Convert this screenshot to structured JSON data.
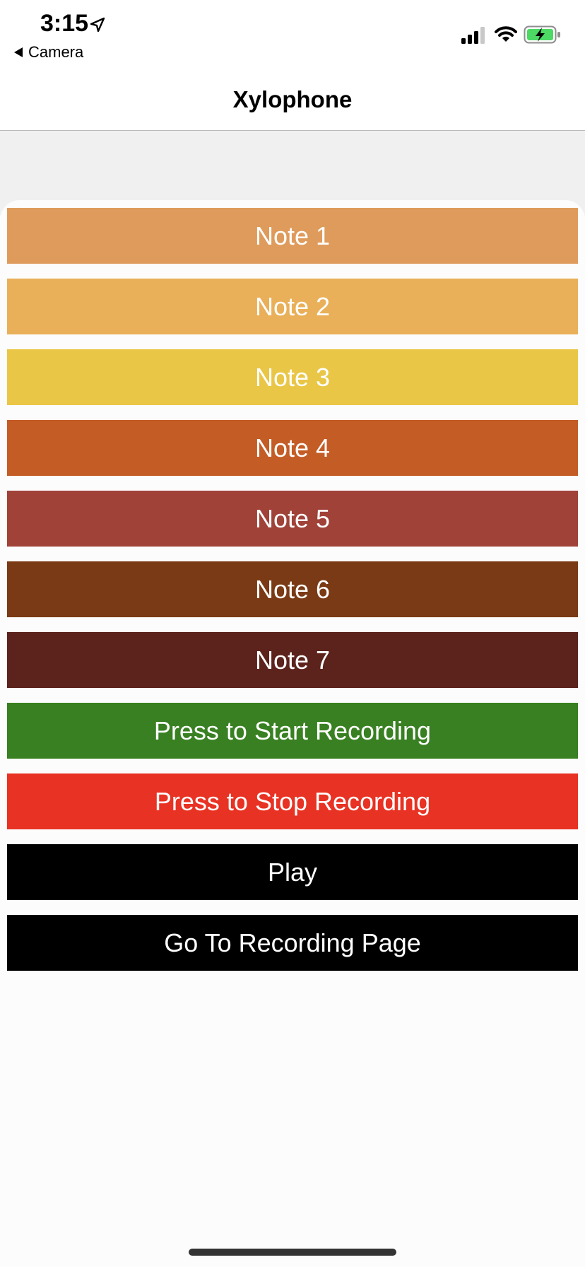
{
  "status_bar": {
    "time": "3:15",
    "back_app": "Camera",
    "battery_color": "#4cd964"
  },
  "nav": {
    "title": "Xylophone"
  },
  "notes": [
    {
      "label": "Note 1",
      "color": "#df9b5b"
    },
    {
      "label": "Note 2",
      "color": "#e9b059"
    },
    {
      "label": "Note 3",
      "color": "#e9c646"
    },
    {
      "label": "Note 4",
      "color": "#c45c25"
    },
    {
      "label": "Note 5",
      "color": "#a04238"
    },
    {
      "label": "Note 6",
      "color": "#7a3a15"
    },
    {
      "label": "Note 7",
      "color": "#5c221c"
    }
  ],
  "controls": {
    "start_recording": {
      "label": "Press to Start Recording",
      "color": "#388021"
    },
    "stop_recording": {
      "label": "Press to Stop Recording",
      "color": "#e83223"
    },
    "play": {
      "label": "Play",
      "color": "#000000"
    },
    "go_to_recording_page": {
      "label": "Go To Recording Page",
      "color": "#000000"
    }
  }
}
